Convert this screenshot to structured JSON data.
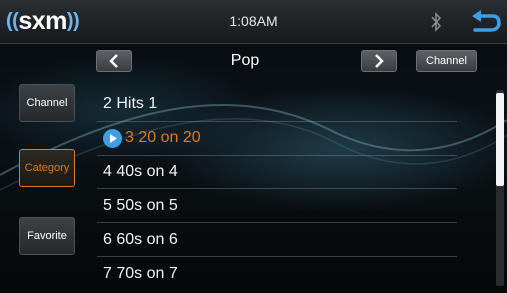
{
  "status": {
    "logo_text": "sxm",
    "time": "1:08AM",
    "icons": [
      "bluetooth-icon",
      "back-arrow-icon"
    ],
    "accent_color": "#6fb6ee"
  },
  "navigation": {
    "prev_icon": "chevron-left-icon",
    "next_icon": "chevron-right-icon",
    "category_title": "Pop",
    "channel_button": "Channel"
  },
  "sidebar": {
    "items": [
      {
        "label": "Channel",
        "active": false
      },
      {
        "label": "Category",
        "active": true
      },
      {
        "label": "Favorite",
        "active": false
      }
    ],
    "active_color": "#e0791f"
  },
  "channels": [
    {
      "label": "2 Hits 1",
      "playing": false
    },
    {
      "label": "3 20 on 20",
      "playing": true
    },
    {
      "label": "4 40s on 4",
      "playing": false
    },
    {
      "label": "5 50s on 5",
      "playing": false
    },
    {
      "label": "6 60s on 6",
      "playing": false
    },
    {
      "label": "7 70s on 7",
      "playing": false
    }
  ]
}
